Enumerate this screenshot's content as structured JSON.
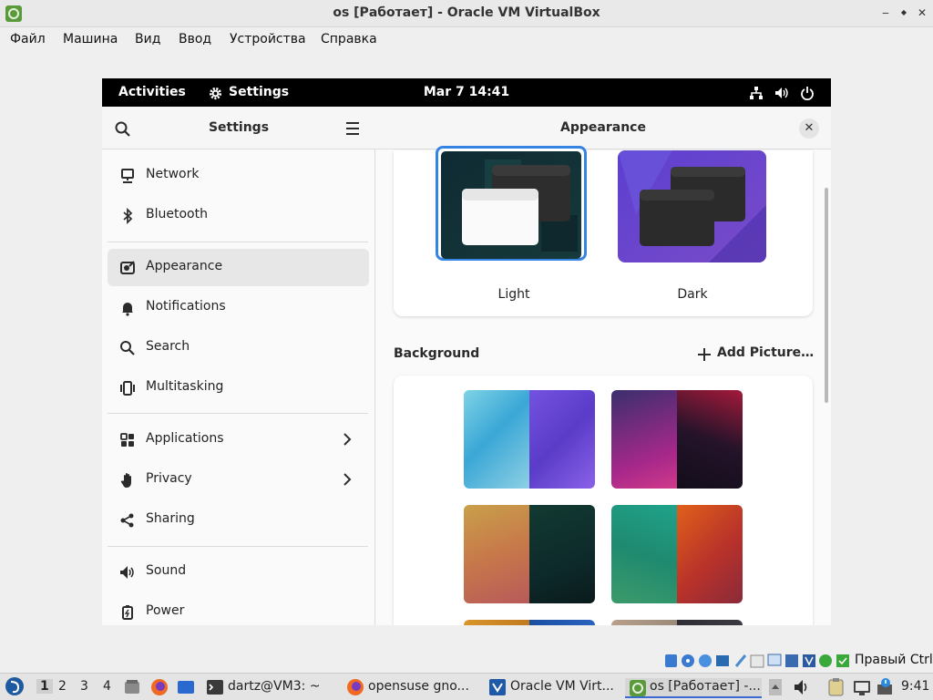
{
  "window": {
    "title": "os [Работает] - Oracle VM VirtualBox",
    "minimize_glyph": "‒",
    "restore_glyph": "◆",
    "close_glyph": "✕"
  },
  "menubar": {
    "items": [
      "Файл",
      "Машина",
      "Вид",
      "Ввод",
      "Устройства",
      "Справка"
    ]
  },
  "gnome_topbar": {
    "activities": "Activities",
    "app_name": "Settings",
    "clock": "Mar 7  14:41",
    "tray_icons": [
      "network-wired-icon",
      "speaker-icon",
      "power-icon"
    ]
  },
  "sidebar": {
    "title": "Settings",
    "items": [
      {
        "label": "Network",
        "icon": "network-icon"
      },
      {
        "label": "Bluetooth",
        "icon": "bluetooth-icon"
      },
      {
        "label": "Appearance",
        "icon": "appearance-icon",
        "active": true
      },
      {
        "label": "Notifications",
        "icon": "bell-icon"
      },
      {
        "label": "Search",
        "icon": "search-icon"
      },
      {
        "label": "Multitasking",
        "icon": "multitasking-icon"
      },
      {
        "label": "Applications",
        "icon": "apps-grid-icon",
        "chevron": true
      },
      {
        "label": "Privacy",
        "icon": "hand-icon",
        "chevron": true
      },
      {
        "label": "Sharing",
        "icon": "share-icon"
      },
      {
        "label": "Sound",
        "icon": "speaker-icon"
      },
      {
        "label": "Power",
        "icon": "power-battery-icon"
      }
    ]
  },
  "content": {
    "title": "Appearance",
    "close_glyph": "✕",
    "style": {
      "options": [
        {
          "label": "Light",
          "selected": true
        },
        {
          "label": "Dark",
          "selected": false
        }
      ]
    },
    "background": {
      "label": "Background",
      "add_label": "Add Picture…"
    }
  },
  "status": {
    "host_key": "Правый Ctrl"
  },
  "taskbar": {
    "workspaces": [
      "1",
      "2",
      "3",
      "4"
    ],
    "current_workspace": "1",
    "tasks": [
      {
        "label": "dartz@VM3: ~",
        "icon": "terminal-icon"
      },
      {
        "label": "opensuse gno...",
        "icon": "firefox-icon"
      },
      {
        "label": "Oracle VM Virt...",
        "icon": "virtualbox-icon"
      },
      {
        "label": "os [Работает] -...",
        "icon": "virtualbox-vm-icon",
        "active": true
      }
    ],
    "time": "9:41"
  },
  "colors": {
    "accent": "#3584e4",
    "topbar": "#000000",
    "sidebar_active": "#e7e7e7"
  }
}
